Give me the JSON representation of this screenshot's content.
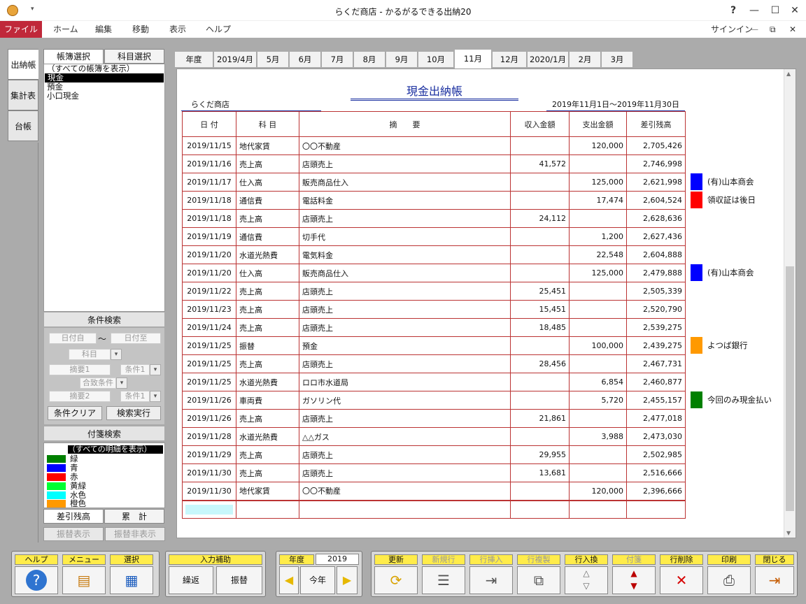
{
  "window": {
    "title": "らくだ商店 - かるがるできる出納20",
    "help": "?",
    "minimize": "—",
    "maximize": "☐",
    "close": "✕"
  },
  "menu": {
    "items": [
      "ファイル",
      "ホーム",
      "編集",
      "移動",
      "表示",
      "ヘルプ"
    ],
    "signin": "サインイン"
  },
  "vtabs": [
    "出納帳",
    "集計表",
    "台帳"
  ],
  "left_panel": {
    "tabs": [
      "帳簿選択",
      "科目選択"
    ],
    "books": [
      "（すべての帳簿を表示）",
      "現金",
      "預金",
      "小口現金"
    ],
    "condition_header": "条件検索",
    "date_from": "日付自",
    "tilde": "〜",
    "date_to": "日付至",
    "subject": "科目",
    "memo1": "摘要1",
    "cond1": "条件1",
    "match": "合致条件",
    "memo2": "摘要2",
    "cond1b": "条件1",
    "clear_btn": "条件クリア",
    "search_btn": "検索実行",
    "tag_header": "付箋検索",
    "tag_all": "（すべての明細を表示）",
    "tags": [
      {
        "label": "緑",
        "color": "#008000"
      },
      {
        "label": "青",
        "color": "#0000ff"
      },
      {
        "label": "赤",
        "color": "#ff0000"
      },
      {
        "label": "黄緑",
        "color": "#00ff33"
      },
      {
        "label": "水色",
        "color": "#00ffff"
      },
      {
        "label": "橙色",
        "color": "#ff9900"
      }
    ],
    "sub_tabs": [
      "差引残高",
      "累　計"
    ],
    "transfer_show": "振替表示",
    "transfer_hide": "振替非表示"
  },
  "month_tabs": [
    "年度",
    "2019/4月",
    "5月",
    "6月",
    "7月",
    "8月",
    "9月",
    "10月",
    "11月",
    "12月",
    "2020/1月",
    "2月",
    "3月"
  ],
  "active_month": "11月",
  "report": {
    "title": "現金出納帳",
    "shop": "らくだ商店",
    "period": "2019年11月1日〜2019年11月30日",
    "headers": [
      "日 付",
      "科 目",
      "摘　　要",
      "収入金額",
      "支出金額",
      "差引残高"
    ],
    "rows": [
      [
        "2019/11/15",
        "地代家賃",
        "〇〇不動産",
        "",
        "120,000",
        "2,705,426"
      ],
      [
        "2019/11/16",
        "売上高",
        "店頭売上",
        "41,572",
        "",
        "2,746,998"
      ],
      [
        "2019/11/17",
        "仕入高",
        "販売商品仕入",
        "",
        "125,000",
        "2,621,998"
      ],
      [
        "2019/11/18",
        "通信費",
        "電話料金",
        "",
        "17,474",
        "2,604,524"
      ],
      [
        "2019/11/18",
        "売上高",
        "店頭売上",
        "24,112",
        "",
        "2,628,636"
      ],
      [
        "2019/11/19",
        "通信費",
        "切手代",
        "",
        "1,200",
        "2,627,436"
      ],
      [
        "2019/11/20",
        "水道光熱費",
        "電気料金",
        "",
        "22,548",
        "2,604,888"
      ],
      [
        "2019/11/20",
        "仕入高",
        "販売商品仕入",
        "",
        "125,000",
        "2,479,888"
      ],
      [
        "2019/11/22",
        "売上高",
        "店頭売上",
        "25,451",
        "",
        "2,505,339"
      ],
      [
        "2019/11/23",
        "売上高",
        "店頭売上",
        "15,451",
        "",
        "2,520,790"
      ],
      [
        "2019/11/24",
        "売上高",
        "店頭売上",
        "18,485",
        "",
        "2,539,275"
      ],
      [
        "2019/11/25",
        "振替",
        "預金",
        "",
        "100,000",
        "2,439,275"
      ],
      [
        "2019/11/25",
        "売上高",
        "店頭売上",
        "28,456",
        "",
        "2,467,731"
      ],
      [
        "2019/11/25",
        "水道光熱費",
        "ロロ市水道局",
        "",
        "6,854",
        "2,460,877"
      ],
      [
        "2019/11/26",
        "車両費",
        "ガソリン代",
        "",
        "5,720",
        "2,455,157"
      ],
      [
        "2019/11/26",
        "売上高",
        "店頭売上",
        "21,861",
        "",
        "2,477,018"
      ],
      [
        "2019/11/28",
        "水道光熱費",
        "△△ガス",
        "",
        "3,988",
        "2,473,030"
      ],
      [
        "2019/11/29",
        "売上高",
        "店頭売上",
        "29,955",
        "",
        "2,502,985"
      ],
      [
        "2019/11/30",
        "売上高",
        "店頭売上",
        "13,681",
        "",
        "2,516,666"
      ],
      [
        "2019/11/30",
        "地代家賃",
        "〇〇不動産",
        "",
        "120,000",
        "2,396,666"
      ]
    ],
    "notes": [
      {
        "row": 2,
        "text": "(有)山本商会",
        "color": "#0000ff"
      },
      {
        "row": 3,
        "text": "領収証は後日",
        "color": "#ff0000"
      },
      {
        "row": 7,
        "text": "(有)山本商会",
        "color": "#0000ff"
      },
      {
        "row": 11,
        "text": "よつば銀行",
        "color": "#ff9900"
      },
      {
        "row": 14,
        "text": "今回のみ現金払い",
        "color": "#008000"
      }
    ]
  },
  "toolbar": {
    "help": "ヘルプ",
    "menu": "メニュー",
    "select": "選択",
    "input_assist": "入力補助",
    "repeat": "繰返",
    "transfer": "振替",
    "year_label": "年度",
    "year_value": "2019",
    "this_year": "今年",
    "update": "更新",
    "new_row": "新規行",
    "insert_row": "行挿入",
    "copy_row": "行複製",
    "swap_row": "行入換",
    "tag": "付箋",
    "delete_row": "行削除",
    "print": "印刷",
    "close": "閉じる"
  }
}
